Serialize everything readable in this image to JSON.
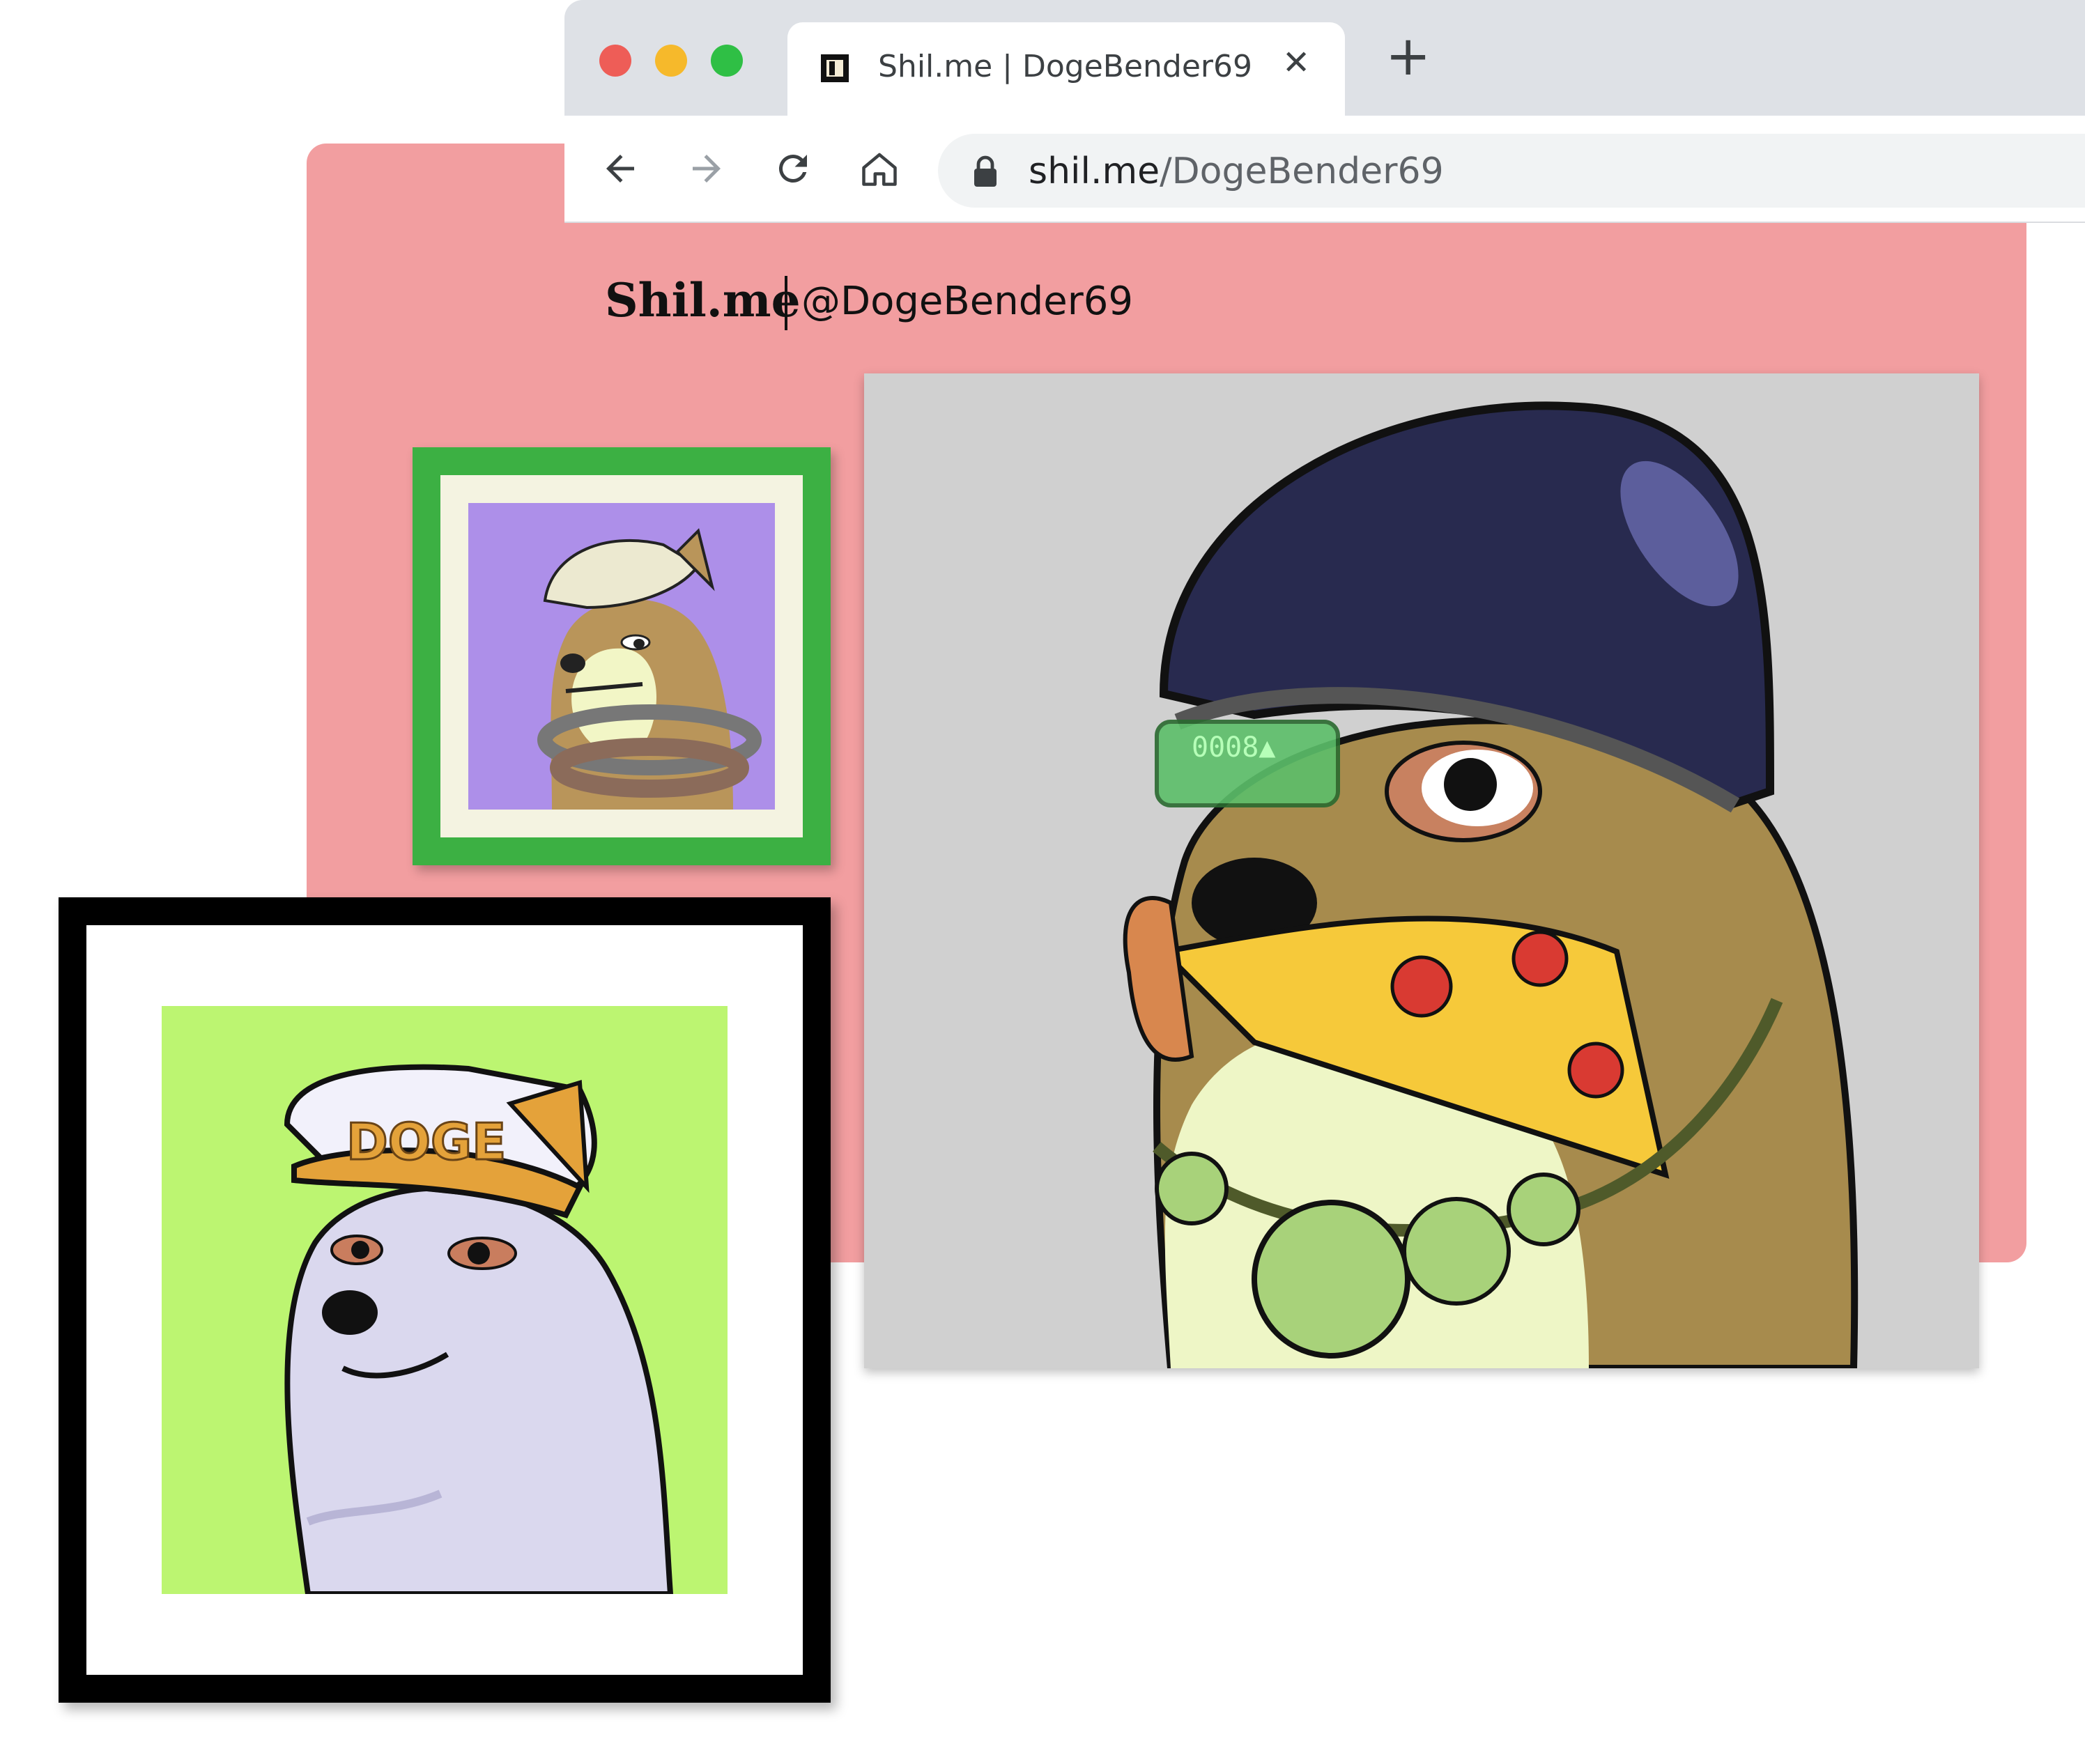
{
  "browser": {
    "tab_title": "Shil.me | DogeBender69",
    "tab_close_icon": "close-icon",
    "new_tab_icon": "plus-icon",
    "url_host": "shil.me",
    "url_path": "/DogeBender69",
    "nav_icons": [
      "back-arrow-icon",
      "forward-arrow-icon",
      "reload-icon",
      "home-icon",
      "lock-icon"
    ]
  },
  "page": {
    "brand": "Shil.me",
    "handle": "@DogeBender69",
    "background_color": "#f29ea0"
  },
  "artworks": {
    "small_frame": {
      "frame_color": "#3cb043",
      "background": "#ad8fe9"
    },
    "left_frame": {
      "frame_color": "#000000",
      "background": "#bcf571",
      "cap_text": "DOGE"
    },
    "main": {
      "background": "#d0d0d0",
      "visor_text": "0008▲"
    }
  }
}
